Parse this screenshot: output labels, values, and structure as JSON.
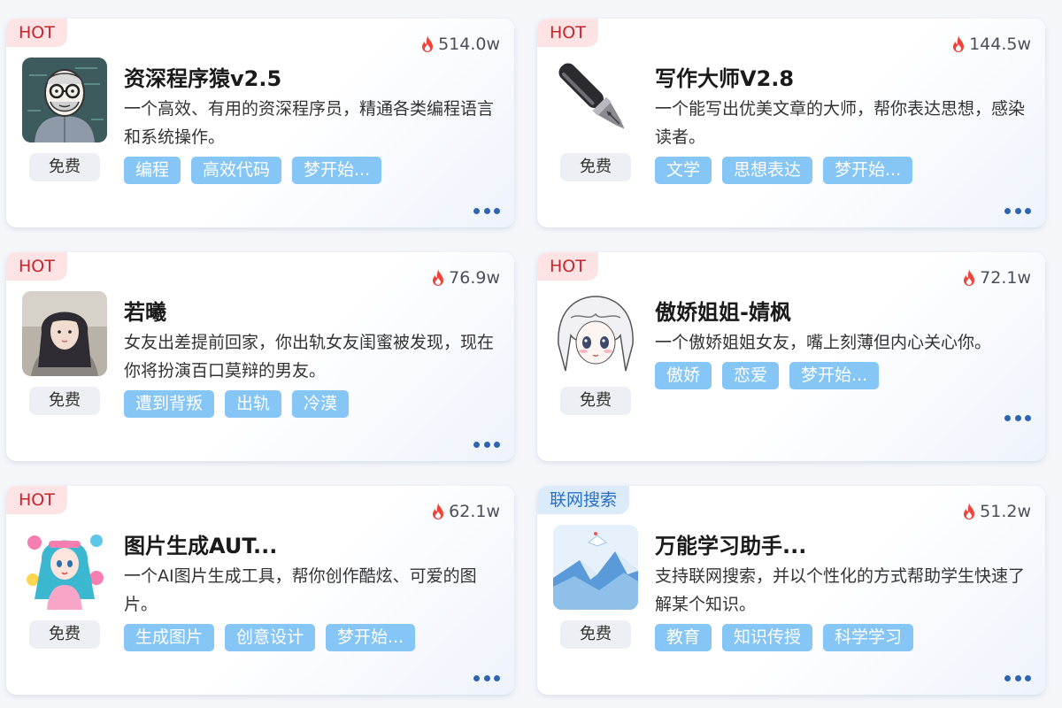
{
  "cards": [
    {
      "badge": "HOT",
      "badge_type": "hot",
      "count": "514.0w",
      "title": "资深程序猿v2.5",
      "desc": "一个高效、有用的资深程序员，精通各类编程语言和系统操作。",
      "price": "免费",
      "tags": [
        "编程",
        "高效代码",
        "梦开始..."
      ],
      "avatar_icon": "programmer-avatar"
    },
    {
      "badge": "HOT",
      "badge_type": "hot",
      "count": "144.5w",
      "title": "写作大师V2.8",
      "desc": "一个能写出优美文章的大师，帮你表达思想，感染读者。",
      "price": "免费",
      "tags": [
        "文学",
        "思想表达",
        "梦开始..."
      ],
      "avatar_icon": "fountain-pen-avatar"
    },
    {
      "badge": "HOT",
      "badge_type": "hot",
      "count": "76.9w",
      "title": "若曦",
      "desc": "女友出差提前回家，你出轨女友闺蜜被发现，现在你将扮演百口莫辩的男友。",
      "price": "免费",
      "tags": [
        "遭到背叛",
        "出轨",
        "冷漠"
      ],
      "avatar_icon": "girl-photo-avatar"
    },
    {
      "badge": "HOT",
      "badge_type": "hot",
      "count": "72.1w",
      "title": "傲娇姐姐-婧枫",
      "desc": "一个傲娇姐姐女友，嘴上刻薄但内心关心你。",
      "price": "免费",
      "tags": [
        "傲娇",
        "恋爱",
        "梦开始..."
      ],
      "avatar_icon": "anime-girl-avatar"
    },
    {
      "badge": "HOT",
      "badge_type": "hot",
      "count": "62.1w",
      "title": "图片生成AUT...",
      "desc": "一个AI图片生成工具，帮你创作酷炫、可爱的图片。",
      "price": "免费",
      "tags": [
        "生成图片",
        "创意设计",
        "梦开始..."
      ],
      "avatar_icon": "colorful-character-avatar"
    },
    {
      "badge": "联网搜索",
      "badge_type": "net",
      "count": "51.2w",
      "title": "万能学习助手...",
      "desc": "支持联网搜索，并以个性化的方式帮助学生快速了解某个知识。",
      "price": "免费",
      "tags": [
        "教育",
        "知识传授",
        "科学学习"
      ],
      "avatar_icon": "paper-landscape-avatar"
    }
  ],
  "colors": {
    "hot_badge_bg": "#fde3e4",
    "hot_badge_text": "#c4262e",
    "net_badge_bg": "#dcebfa",
    "net_badge_text": "#2770c8",
    "tag_bg": "#86c6f7",
    "more_dots": "#2f64b0",
    "flame": "#f0443a"
  }
}
